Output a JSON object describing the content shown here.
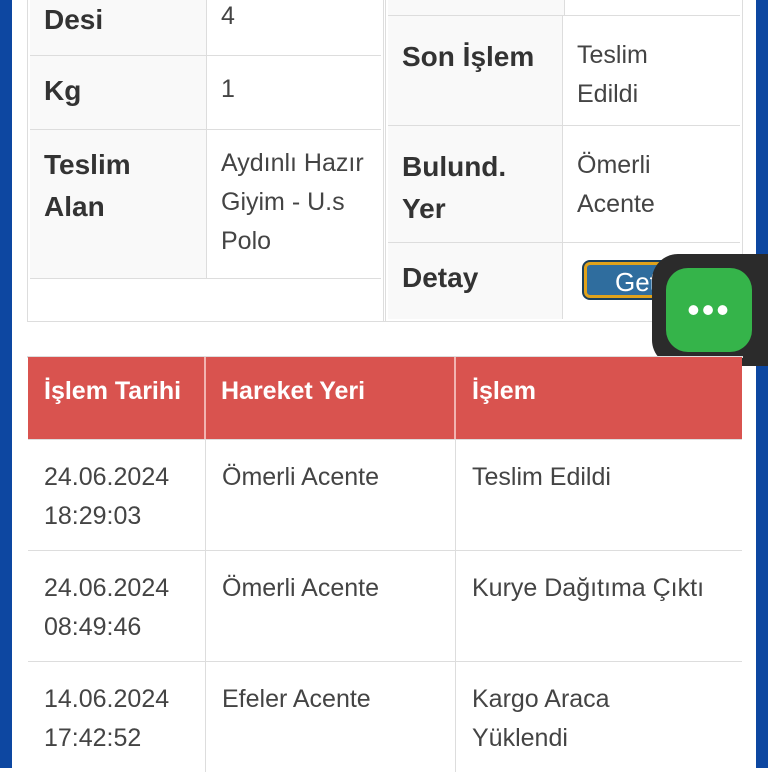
{
  "details_left": [
    {
      "key": "Desi",
      "value": "4"
    },
    {
      "key": "Kg",
      "value": "1"
    },
    {
      "key": "Teslim Alan",
      "value": "Aydınlı Hazır Giyim - U.s Polo"
    }
  ],
  "details_right": [
    {
      "key": "Son İşlem",
      "value": "Teslim Edildi"
    },
    {
      "key": "Bulund. Yer",
      "value": "Ömerli Acente"
    },
    {
      "key": "Detay",
      "value": ""
    }
  ],
  "detail_button_label": "Getir",
  "fab_label": "•••",
  "table": {
    "headers": [
      "İşlem Tarihi",
      "Hareket Yeri",
      "İşlem"
    ],
    "rows": [
      {
        "date": "24.06.2024",
        "time": "18:29:03",
        "place": "Ömerli Acente",
        "action": "Teslim Edildi"
      },
      {
        "date": "24.06.2024",
        "time": "08:49:46",
        "place": "Ömerli Acente",
        "action": "Kurye Dağıtıma Çıktı"
      },
      {
        "date": "14.06.2024",
        "time": "17:42:52",
        "place": "Efeler Acente",
        "action": "Kargo Araca Yüklendi"
      }
    ]
  },
  "colors": {
    "header_red": "#d9534f",
    "edge_blue": "#0d47a1",
    "fab_green": "#35b44a"
  }
}
